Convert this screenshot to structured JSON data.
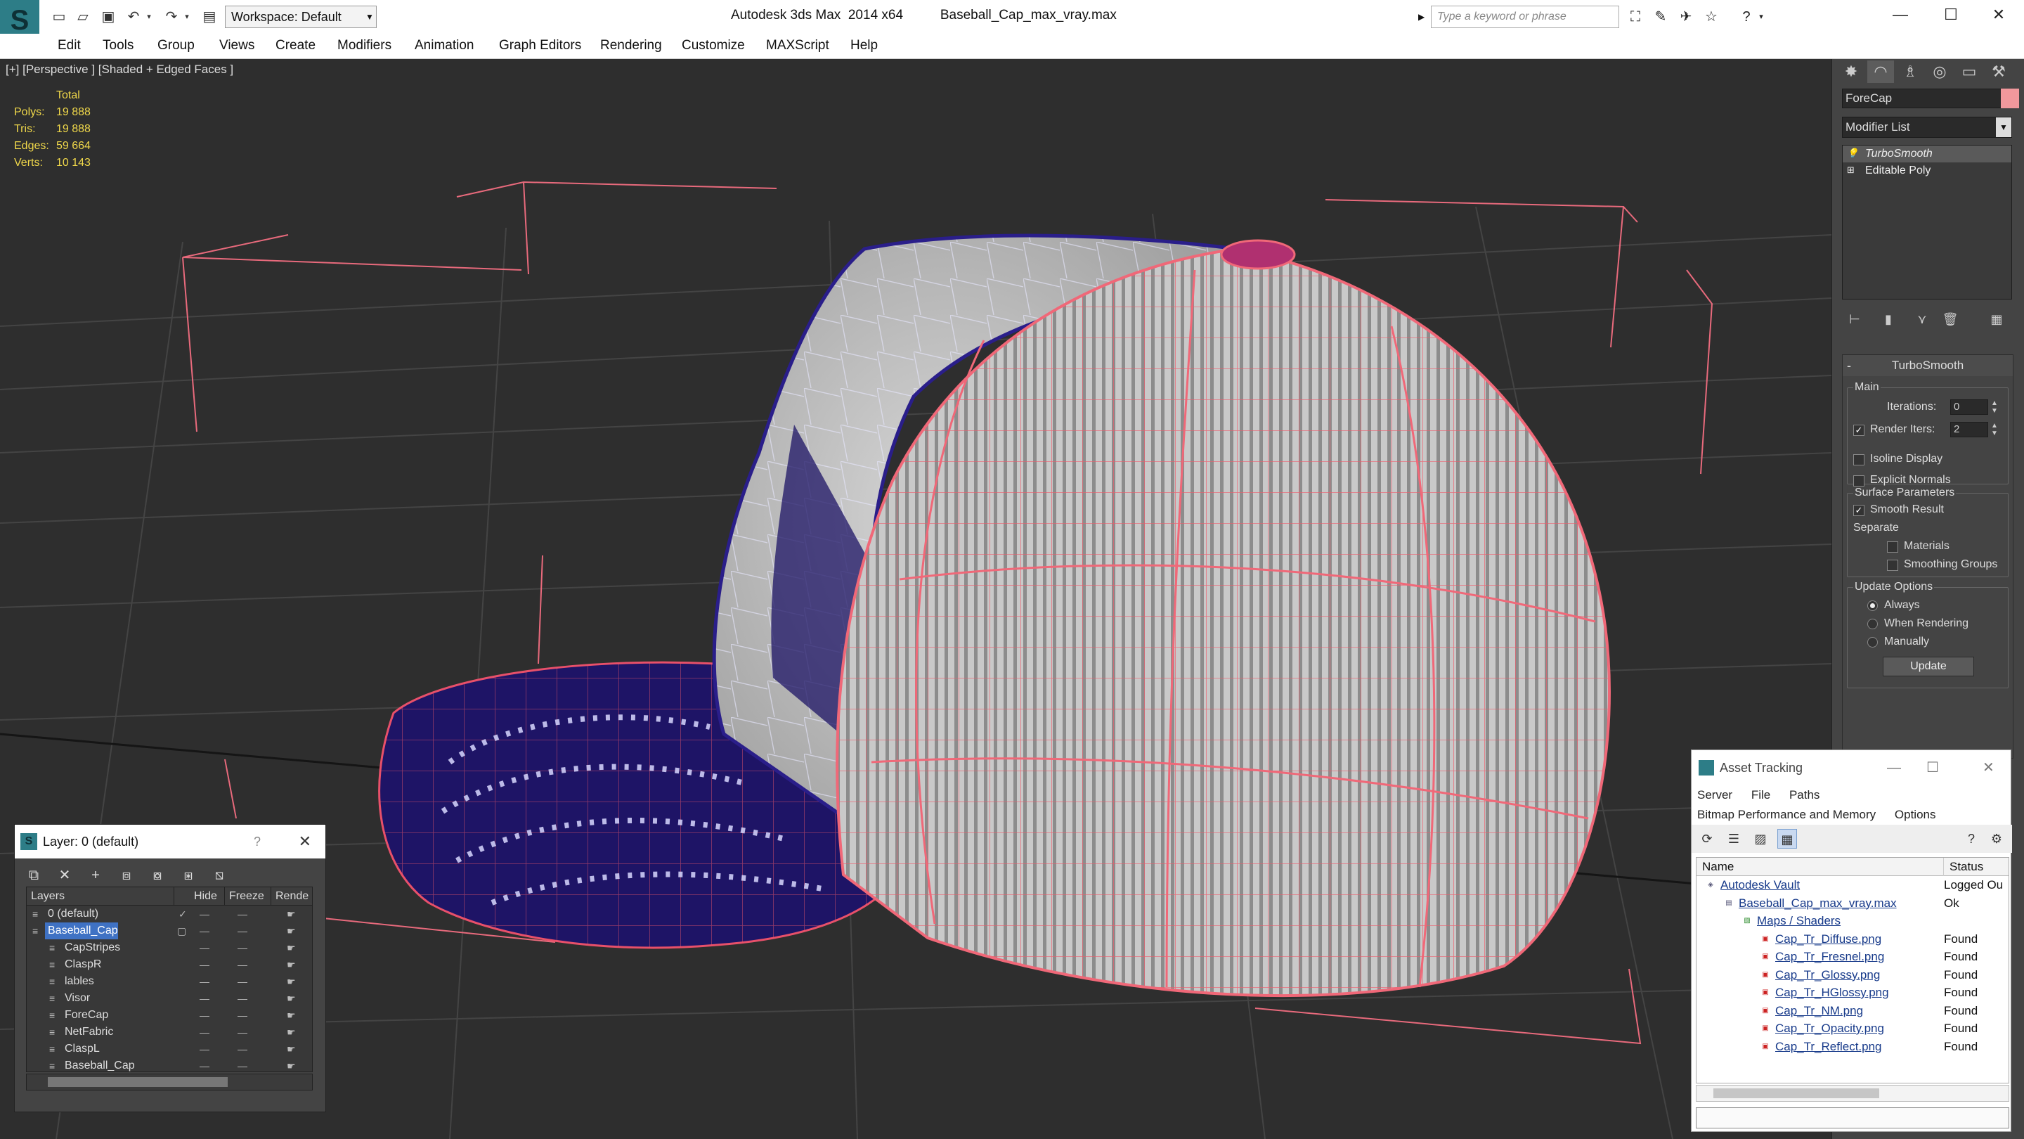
{
  "titlebar": {
    "app_title": "Autodesk 3ds Max  2014 x64",
    "file_title": "Baseball_Cap_max_vray.max",
    "workspace": "Workspace: Default",
    "search_placeholder": "Type a keyword or phrase"
  },
  "menu": [
    "Edit",
    "Tools",
    "Group",
    "Views",
    "Create",
    "Modifiers",
    "Animation",
    "Graph Editors",
    "Rendering",
    "Customize",
    "MAXScript",
    "Help"
  ],
  "viewport": {
    "label": "[+] [Perspective ] [Shaded + Edged Faces ]",
    "stats": {
      "header": "Total",
      "rows": [
        {
          "label": "Polys:",
          "value": "19 888"
        },
        {
          "label": "Tris:",
          "value": "19 888"
        },
        {
          "label": "Edges:",
          "value": "59 664"
        },
        {
          "label": "Verts:",
          "value": "10 143"
        }
      ]
    }
  },
  "command_panel": {
    "object_name": "ForeCap",
    "object_color": "#f1989c",
    "modifier_list": "Modifier List",
    "stack": [
      {
        "label": "TurboSmooth",
        "selected": true
      },
      {
        "label": "Editable Poly",
        "selected": false
      }
    ],
    "turbosmooth": {
      "title": "TurboSmooth",
      "main": "Main",
      "iterations_label": "Iterations:",
      "iterations_value": "0",
      "render_iters_label": "Render Iters:",
      "render_iters_value": "2",
      "render_iters_checked": true,
      "isoline_display": "Isoline Display",
      "explicit_normals": "Explicit Normals",
      "surface_parameters": "Surface Parameters",
      "smooth_result": "Smooth Result",
      "separate": "Separate",
      "materials": "Materials",
      "smoothing_groups": "Smoothing Groups",
      "update_options": "Update Options",
      "always": "Always",
      "when_rendering": "When Rendering",
      "manually": "Manually",
      "update_button": "Update"
    }
  },
  "layer_window": {
    "title": "Layer: 0 (default)",
    "help": "?",
    "columns": [
      "Layers",
      "Hide",
      "Freeze",
      "Rende"
    ],
    "rows": [
      {
        "name": "0 (default)",
        "indent": 1,
        "selected": false
      },
      {
        "name": "Baseball_Cap",
        "indent": 1,
        "selected": true
      },
      {
        "name": "CapStripes",
        "indent": 2,
        "selected": false
      },
      {
        "name": "ClaspR",
        "indent": 2,
        "selected": false
      },
      {
        "name": "lables",
        "indent": 2,
        "selected": false
      },
      {
        "name": "Visor",
        "indent": 2,
        "selected": false
      },
      {
        "name": "ForeCap",
        "indent": 2,
        "selected": false
      },
      {
        "name": "NetFabric",
        "indent": 2,
        "selected": false
      },
      {
        "name": "ClaspL",
        "indent": 2,
        "selected": false
      },
      {
        "name": "Baseball_Cap",
        "indent": 2,
        "selected": false
      }
    ]
  },
  "asset_tracking": {
    "title": "Asset Tracking",
    "menu1": [
      "Server",
      "File",
      "Paths"
    ],
    "menu2": [
      "Bitmap Performance and Memory",
      "Options"
    ],
    "columns": [
      "Name",
      "Status"
    ],
    "rows": [
      {
        "name": "Autodesk Vault",
        "status": "Logged Ou",
        "level": 0
      },
      {
        "name": "Baseball_Cap_max_vray.max",
        "status": "Ok",
        "level": 1
      },
      {
        "name": "Maps / Shaders",
        "status": "",
        "level": 2
      },
      {
        "name": "Cap_Tr_Diffuse.png",
        "status": "Found",
        "level": 3
      },
      {
        "name": "Cap_Tr_Fresnel.png",
        "status": "Found",
        "level": 3
      },
      {
        "name": "Cap_Tr_Glossy.png",
        "status": "Found",
        "level": 3
      },
      {
        "name": "Cap_Tr_HGlossy.png",
        "status": "Found",
        "level": 3
      },
      {
        "name": "Cap_Tr_NM.png",
        "status": "Found",
        "level": 3
      },
      {
        "name": "Cap_Tr_Opacity.png",
        "status": "Found",
        "level": 3
      },
      {
        "name": "Cap_Tr_Reflect.png",
        "status": "Found",
        "level": 3
      }
    ]
  }
}
